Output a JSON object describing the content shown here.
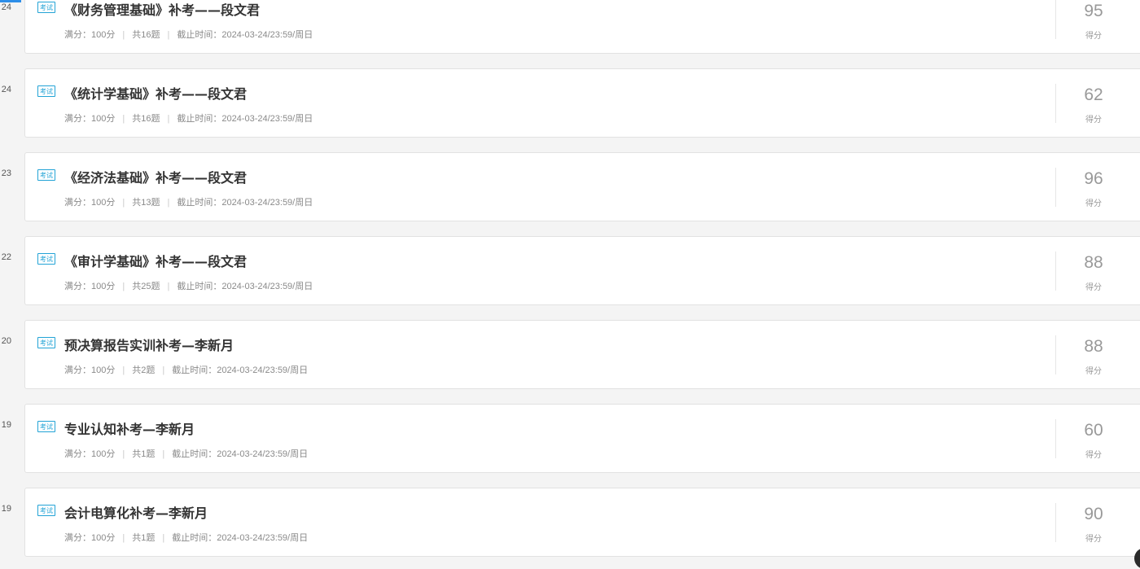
{
  "score_label": "得分",
  "tag_label": "考试",
  "separator": "|",
  "exams": [
    {
      "day": "24",
      "title": "《财务管理基础》补考——段文君",
      "full_score": "满分：100分",
      "count": "共16题",
      "deadline": "截止时间：2024-03-24/23:59/周日",
      "score": "95"
    },
    {
      "day": "24",
      "title": "《统计学基础》补考——段文君",
      "full_score": "满分：100分",
      "count": "共16题",
      "deadline": "截止时间：2024-03-24/23:59/周日",
      "score": "62"
    },
    {
      "day": "23",
      "title": "《经济法基础》补考——段文君",
      "full_score": "满分：100分",
      "count": "共13题",
      "deadline": "截止时间：2024-03-24/23:59/周日",
      "score": "96"
    },
    {
      "day": "22",
      "title": "《审计学基础》补考——段文君",
      "full_score": "满分：100分",
      "count": "共25题",
      "deadline": "截止时间：2024-03-24/23:59/周日",
      "score": "88"
    },
    {
      "day": "20",
      "title": "预决算报告实训补考—李新月",
      "full_score": "满分：100分",
      "count": "共2题",
      "deadline": "截止时间：2024-03-24/23:59/周日",
      "score": "88"
    },
    {
      "day": "19",
      "title": "专业认知补考—李新月",
      "full_score": "满分：100分",
      "count": "共1题",
      "deadline": "截止时间：2024-03-24/23:59/周日",
      "score": "60"
    },
    {
      "day": "19",
      "title": "会计电算化补考—李新月",
      "full_score": "满分：100分",
      "count": "共1题",
      "deadline": "截止时间：2024-03-24/23:59/周日",
      "score": "90"
    }
  ]
}
